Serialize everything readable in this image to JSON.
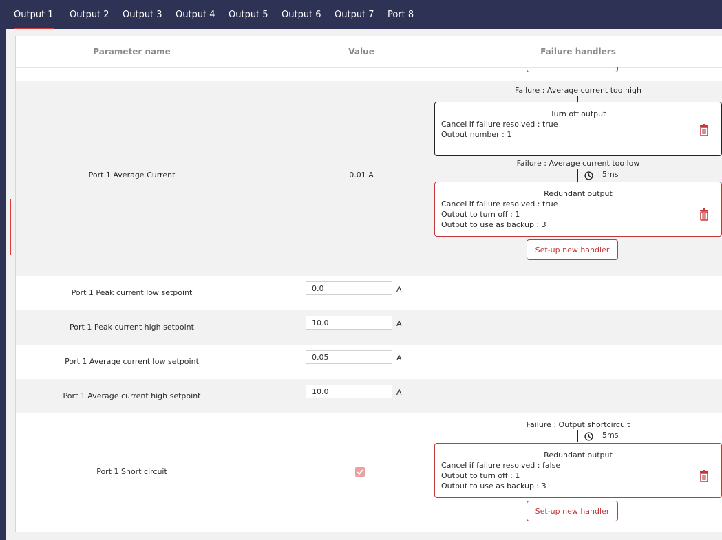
{
  "tabs": [
    "Output 1",
    "Output 2",
    "Output 3",
    "Output 4",
    "Output 5",
    "Output 6",
    "Output 7",
    "Port 8"
  ],
  "header": {
    "param": "Parameter name",
    "value": "Value",
    "handlers": "Failure handlers"
  },
  "avg_row": {
    "name": "Port 1 Average Current",
    "value": "0.01 A",
    "failure1": "Failure : Average current too high",
    "handler1": {
      "title": "Turn off output",
      "line1": "Cancel if failure resolved : true",
      "line2": "Output number : 1"
    },
    "failure2": "Failure : Average current too low",
    "timer2": "5ms",
    "handler2": {
      "title": "Redundant output",
      "line1": "Cancel if failure resolved : true",
      "line2": "Output to turn off : 1",
      "line3": "Output to use as backup : 3"
    },
    "setup": "Set-up new handler"
  },
  "setpoints": [
    {
      "name": "Port 1 Peak current low setpoint",
      "value": "0.0",
      "unit": "A"
    },
    {
      "name": "Port 1 Peak current high setpoint",
      "value": "10.0",
      "unit": "A"
    },
    {
      "name": "Port 1 Average current low setpoint",
      "value": "0.05",
      "unit": "A"
    },
    {
      "name": "Port 1 Average current high setpoint",
      "value": "10.0",
      "unit": "A"
    }
  ],
  "short_row": {
    "name": "Port 1 Short circuit",
    "failure": "Failure : Output shortcircuit",
    "timer": "5ms",
    "handler": {
      "title": "Redundant output",
      "line1": "Cancel if failure resolved : false",
      "line2": "Output to turn off : 1",
      "line3": "Output to use as backup : 3"
    },
    "setup": "Set-up new handler"
  },
  "colors": {
    "nav": "#2e3254",
    "accent": "#c4373a"
  }
}
